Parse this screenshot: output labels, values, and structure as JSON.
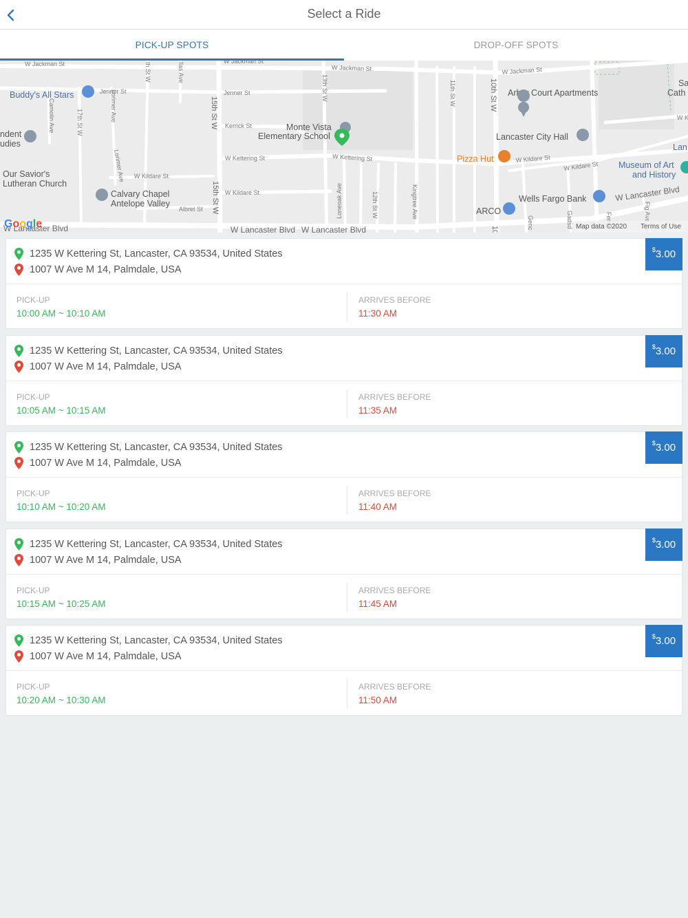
{
  "header": {
    "title": "Select a Ride",
    "back_icon": "chevron-left-icon"
  },
  "tabs": [
    {
      "label": "PICK-UP SPOTS",
      "active": true
    },
    {
      "label": "DROP-OFF SPOTS",
      "active": false
    }
  ],
  "map": {
    "google_logo": "Google",
    "attribution": "Map data ©2020",
    "terms": "Terms of Use",
    "streets": [
      "W Jackman St",
      "W Jackman St",
      "W Jackman St",
      "W Jackman St",
      "Jenner St",
      "Jenner St",
      "Kerrick St",
      "W Kettering St",
      "W Kettering St",
      "W Kildare St",
      "W Kildare St",
      "W Kildare St",
      "W Kildare St",
      "Albret St",
      "W Lancaster Blvd",
      "W Lancaster Blvd",
      "W Lancaster Blvd",
      "W Lancaster Blvd",
      "15th St W",
      "15th St W",
      "17th St W",
      "13th St W",
      "11th St W",
      "10th St W",
      "Lorimer Ave",
      "Lorimer Ave",
      "Camolin Ave",
      "Loneoak Ave",
      "12th St W",
      "Kingtree Ave",
      "th St W",
      "llas Ave",
      "W K",
      "Genc",
      "Gadsd",
      "Fig Ave",
      "Fern",
      "10"
    ],
    "places": [
      "Buddy's All Stars",
      "Arbor Court Apartments",
      "Monte Vista",
      "Elementary School",
      "Lancaster City Hall",
      "Pizza Hut",
      "Museum of Art",
      "and History",
      "Wells Fargo Bank",
      "ARCO",
      "Our Savior's",
      "Lutheran Church",
      "Calvary Chapel",
      "Antelope Valley",
      "ndent",
      "udies",
      "Sa",
      "Cath",
      "Lan"
    ]
  },
  "colors": {
    "accent": "#2a78c3",
    "pickup_green": "#36b85b",
    "arrive_red": "#e04a3b"
  },
  "rides": [
    {
      "price_symbol": "$",
      "price": "3.00",
      "from": "1235 W Kettering St, Lancaster, CA 93534, United States",
      "to": "1007 W Ave M 14, Palmdale, USA",
      "pickup_label": "PICK-UP",
      "pickup_time": "10:00 AM ~ 10:10 AM",
      "arrive_label": "ARRIVES BEFORE",
      "arrive_time": "11:30 AM"
    },
    {
      "price_symbol": "$",
      "price": "3.00",
      "from": "1235 W Kettering St, Lancaster, CA 93534, United States",
      "to": "1007 W Ave M 14, Palmdale, USA",
      "pickup_label": "PICK-UP",
      "pickup_time": "10:05 AM ~ 10:15 AM",
      "arrive_label": "ARRIVES BEFORE",
      "arrive_time": "11:35 AM"
    },
    {
      "price_symbol": "$",
      "price": "3.00",
      "from": "1235 W Kettering St, Lancaster, CA 93534, United States",
      "to": "1007 W Ave M 14, Palmdale, USA",
      "pickup_label": "PICK-UP",
      "pickup_time": "10:10 AM ~ 10:20 AM",
      "arrive_label": "ARRIVES BEFORE",
      "arrive_time": "11:40 AM"
    },
    {
      "price_symbol": "$",
      "price": "3.00",
      "from": "1235 W Kettering St, Lancaster, CA 93534, United States",
      "to": "1007 W Ave M 14, Palmdale, USA",
      "pickup_label": "PICK-UP",
      "pickup_time": "10:15 AM ~ 10:25 AM",
      "arrive_label": "ARRIVES BEFORE",
      "arrive_time": "11:45 AM"
    },
    {
      "price_symbol": "$",
      "price": "3.00",
      "from": "1235 W Kettering St, Lancaster, CA 93534, United States",
      "to": "1007 W Ave M 14, Palmdale, USA",
      "pickup_label": "PICK-UP",
      "pickup_time": "10:20 AM ~ 10:30 AM",
      "arrive_label": "ARRIVES BEFORE",
      "arrive_time": "11:50 AM"
    }
  ]
}
